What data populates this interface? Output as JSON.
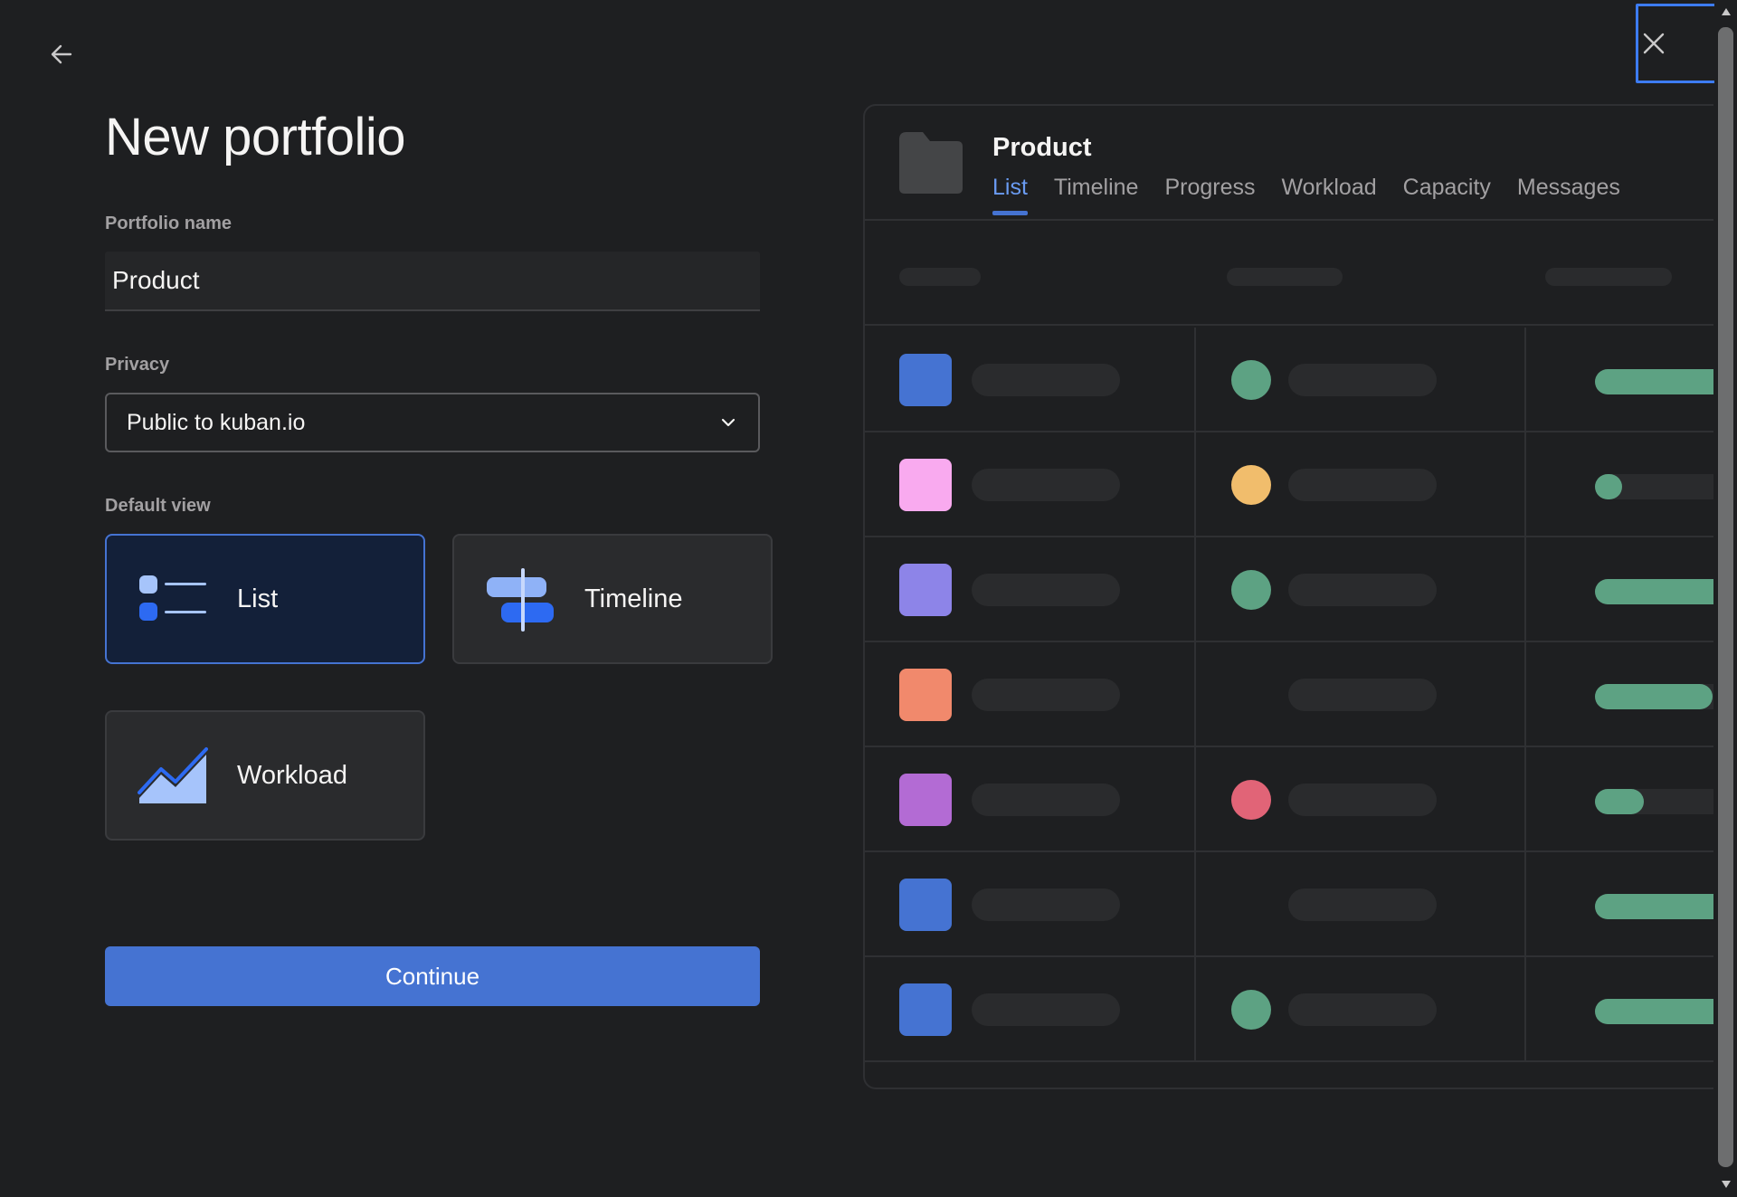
{
  "title": "New portfolio",
  "portfolio_name": {
    "label": "Portfolio name",
    "value": "Product"
  },
  "privacy": {
    "label": "Privacy",
    "value": "Public to kuban.io"
  },
  "default_view": {
    "label": "Default view",
    "options": [
      {
        "label": "List",
        "icon": "list-icon",
        "selected": true
      },
      {
        "label": "Timeline",
        "icon": "timeline-icon",
        "selected": false
      },
      {
        "label": "Workload",
        "icon": "workload-icon",
        "selected": false
      }
    ]
  },
  "continue_label": "Continue",
  "preview": {
    "title": "Product",
    "tabs": [
      "List",
      "Timeline",
      "Progress",
      "Workload",
      "Capacity",
      "Messages"
    ],
    "active_tab": "List",
    "rows": [
      {
        "color": "#4573d2",
        "status": "#5da283",
        "progress": 0.9
      },
      {
        "color": "#f9aaef",
        "status": "#f1bd6c",
        "progress": 0.15
      },
      {
        "color": "#8d84e8",
        "status": "#5da283",
        "progress": 0.9
      },
      {
        "color": "#f1896c",
        "status": null,
        "progress": 0.65
      },
      {
        "color": "#b36bd4",
        "status": "#e16477",
        "progress": 0.27
      },
      {
        "color": "#4573d2",
        "status": null,
        "progress": 0.9
      },
      {
        "color": "#4573d2",
        "status": "#5da283",
        "progress": 0.9
      }
    ]
  },
  "colors": {
    "accent": "#4573d2",
    "background": "#1e1f21",
    "selected_card": "#132039"
  }
}
